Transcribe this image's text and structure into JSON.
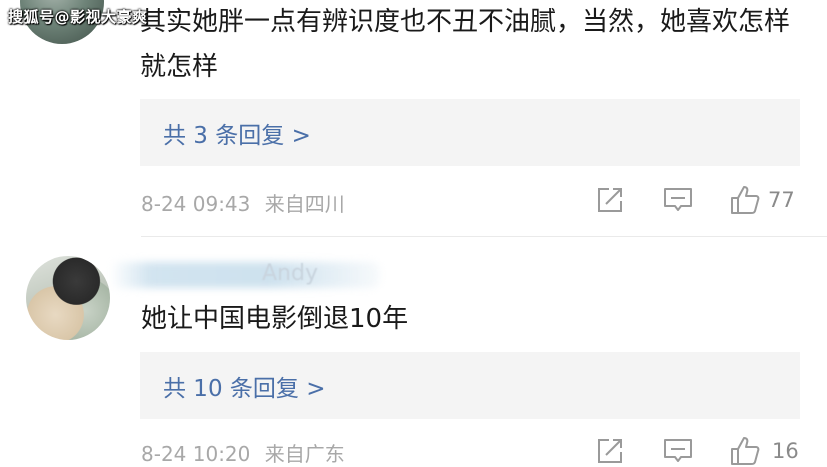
{
  "watermark": "搜狐号@影视大豪爽",
  "comments": [
    {
      "text": "其实她胖一点有辨识度也不丑不油腻，当然，她喜欢怎样就怎样",
      "reply_label": "共 3 条回复 >",
      "timestamp": "8-24 09:43",
      "location": "来自四川",
      "likes": "77"
    },
    {
      "username": "Andy",
      "text": "她让中国电影倒退10年",
      "reply_label": "共 10 条回复 >",
      "timestamp": "8-24 10:20",
      "location": "来自广东",
      "likes": "16"
    }
  ],
  "icons": {
    "share": "share-icon",
    "comment": "comment-icon",
    "like": "thumbs-up-icon"
  },
  "colors": {
    "reply_link": "#4a6fa8",
    "reply_bg": "#f4f4f4",
    "meta_text": "#a8a8a8",
    "body_text": "#1a1a1a"
  }
}
